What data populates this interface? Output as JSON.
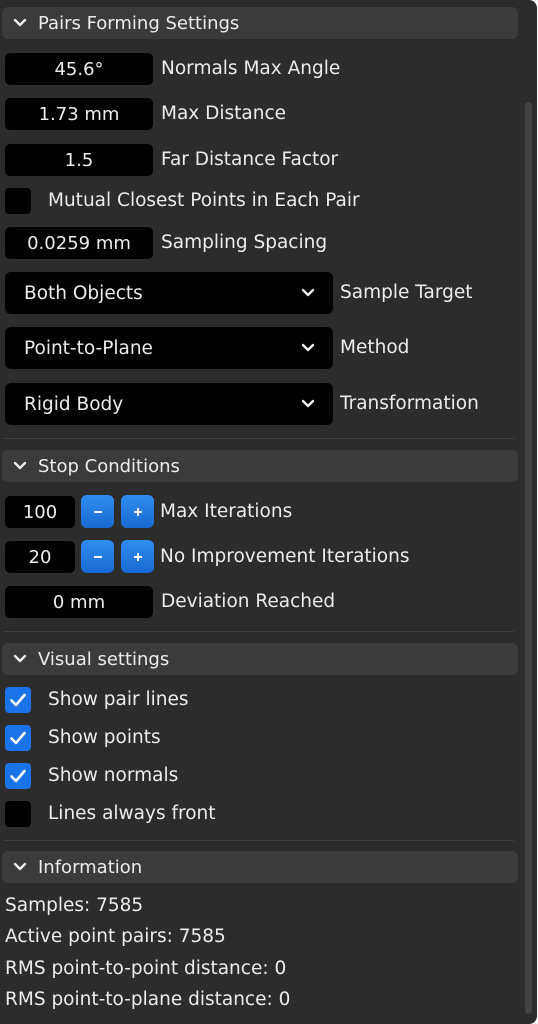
{
  "pairs_forming": {
    "title": "Pairs Forming Settings",
    "normals_max_angle": {
      "value": "45.6°",
      "label": "Normals Max Angle"
    },
    "max_distance": {
      "value": "1.73 mm",
      "label": "Max Distance"
    },
    "far_distance_factor": {
      "value": "1.5",
      "label": "Far Distance Factor"
    },
    "mutual_closest": {
      "label": "Mutual Closest Points in Each Pair",
      "checked": false
    },
    "sampling_spacing": {
      "value": "0.0259 mm",
      "label": "Sampling Spacing"
    },
    "sample_target": {
      "value": "Both Objects",
      "label": "Sample Target"
    },
    "method": {
      "value": "Point-to-Plane",
      "label": "Method"
    },
    "transformation": {
      "value": "Rigid Body",
      "label": "Transformation"
    }
  },
  "stop_conditions": {
    "title": "Stop Conditions",
    "max_iterations": {
      "value": "100",
      "label": "Max Iterations"
    },
    "no_improvement_iterations": {
      "value": "20",
      "label": "No Improvement Iterations"
    },
    "deviation_reached": {
      "value": "0 mm",
      "label": "Deviation Reached"
    },
    "minus_symbol": "−",
    "plus_symbol": "+"
  },
  "visual_settings": {
    "title": "Visual settings",
    "show_pair_lines": {
      "label": "Show pair lines",
      "checked": true
    },
    "show_points": {
      "label": "Show points",
      "checked": true
    },
    "show_normals": {
      "label": "Show normals",
      "checked": true
    },
    "lines_always_front": {
      "label": "Lines always front",
      "checked": false
    }
  },
  "information": {
    "title": "Information",
    "samples": "Samples: 7585",
    "active_point_pairs": "Active point pairs: 7585",
    "rms_point_to_point": "RMS point-to-point distance: 0",
    "rms_point_to_plane": "RMS point-to-plane distance: 0"
  },
  "icons": {
    "collapse": "chevron-down-icon",
    "dropdown": "chevron-down-icon",
    "check": "check-icon"
  },
  "colors": {
    "panel_bg": "#2c2c2c",
    "header_bg": "#3b3b3b",
    "field_bg": "#000000",
    "accent": "#1a73e8",
    "text": "#ececec"
  }
}
